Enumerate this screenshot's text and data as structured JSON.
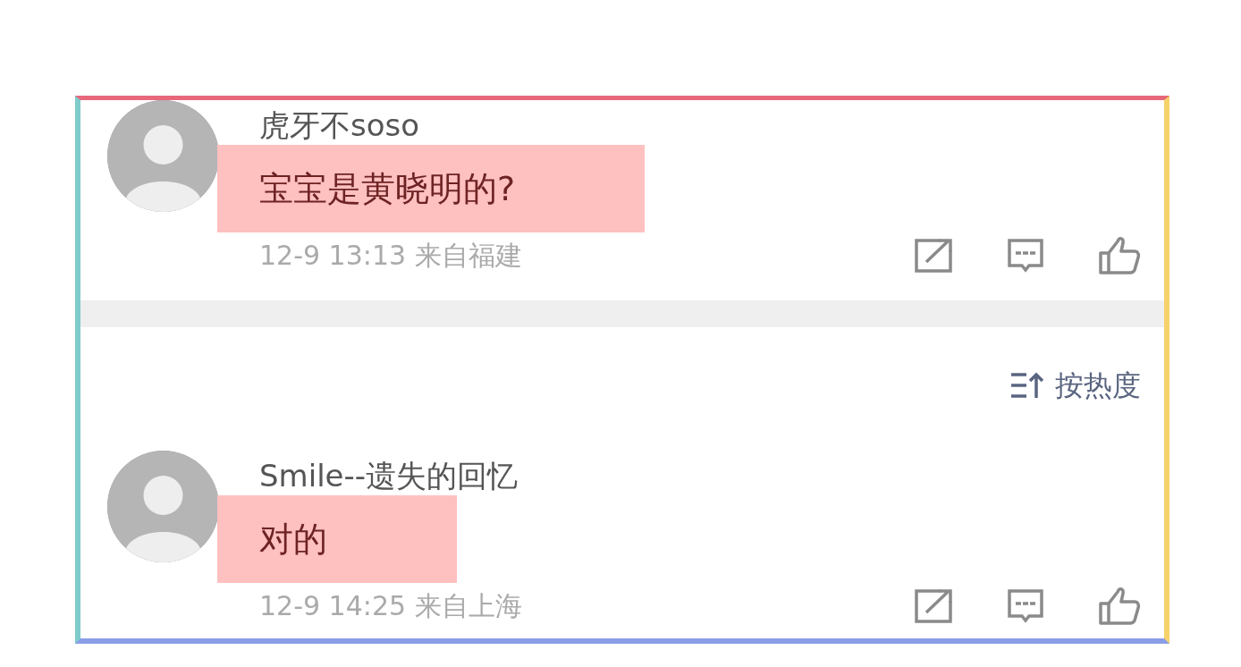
{
  "comments_top": [
    {
      "username": "虎牙不soso",
      "content": "宝宝是黄晓明的?",
      "highlighted": true,
      "time": "12-9 13:13",
      "location": "来自福建"
    }
  ],
  "sort": {
    "label": "按热度"
  },
  "comments": [
    {
      "username": "Smile--遗失的回忆",
      "content": "对的",
      "highlighted": true,
      "time": "12-9 14:25",
      "location": "来自上海"
    }
  ]
}
